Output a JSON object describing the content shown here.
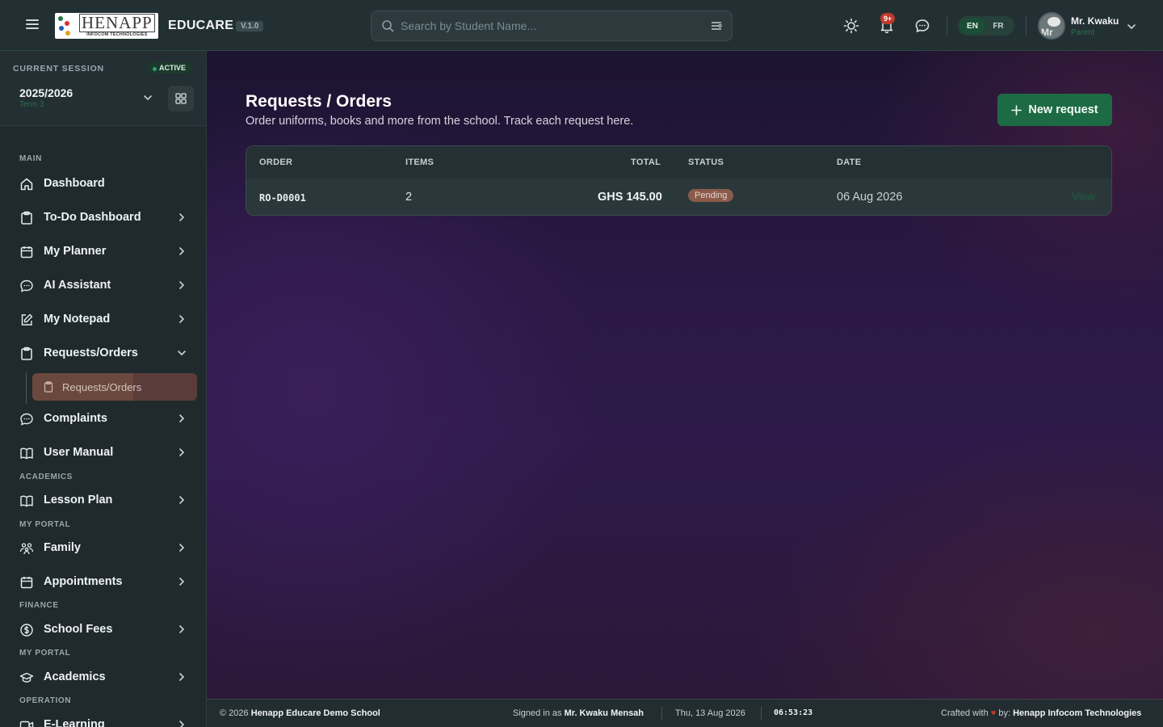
{
  "header": {
    "logo_main": "HENAPP",
    "logo_sub": "INFOCOM TECHNOLOGIES",
    "brand": "EDUCARE",
    "version": "V.1.0",
    "search_placeholder": "Search by Student Name...",
    "notifications_badge": "9+",
    "lang_en": "EN",
    "lang_fr": "FR",
    "user_name": "Mr. Kwaku",
    "user_role": "Parent",
    "avatar_initials": "Mr"
  },
  "session": {
    "label": "CURRENT SESSION",
    "status": "ACTIVE",
    "year": "2025/2026",
    "term": "Term 3"
  },
  "sidebar": {
    "sections": {
      "main": "MAIN",
      "academics": "ACADEMICS",
      "my_portal": "MY PORTAL",
      "finance": "FINANCE",
      "my_portal_2": "MY PORTAL",
      "operation": "OPERATION"
    },
    "items": [
      {
        "label": "Dashboard"
      },
      {
        "label": "To-Do Dashboard"
      },
      {
        "label": "My Planner"
      },
      {
        "label": "AI Assistant"
      },
      {
        "label": "My Notepad"
      },
      {
        "label": "Requests/Orders"
      },
      {
        "label": "Complaints"
      },
      {
        "label": "User Manual"
      },
      {
        "label": "Lesson Plan"
      },
      {
        "label": "Family"
      },
      {
        "label": "Appointments"
      },
      {
        "label": "School Fees"
      },
      {
        "label": "Academics"
      },
      {
        "label": "E-Learning"
      }
    ],
    "sub_item": "Requests/Orders"
  },
  "main": {
    "title": "Requests / Orders",
    "subtitle": "Order uniforms, books and more from the school. Track each request here.",
    "new_button": "New request",
    "table": {
      "columns": [
        "ORDER",
        "ITEMS",
        "TOTAL",
        "STATUS",
        "DATE"
      ],
      "rows": [
        {
          "order": "RO-D0001",
          "items": "2",
          "total": "GHS 145.00",
          "status": "Pending",
          "date": "06 Aug 2026",
          "action": "View"
        }
      ]
    }
  },
  "footer": {
    "copyright": "© 2026",
    "school": "Henapp Educare Demo School",
    "signed_label": "Signed in as",
    "signed_user": "Mr. Kwaku Mensah",
    "date": "Thu, 13 Aug 2026",
    "time": "06:53:23",
    "crafted_label": "Crafted with",
    "crafted_by": "by:",
    "company": "Henapp Infocom Technologies"
  },
  "colors": {
    "accent_green": "#1d6b45",
    "status_pending": "#8a5a4a",
    "active_green": "#2ea36b",
    "notif_red": "#c0392b"
  }
}
